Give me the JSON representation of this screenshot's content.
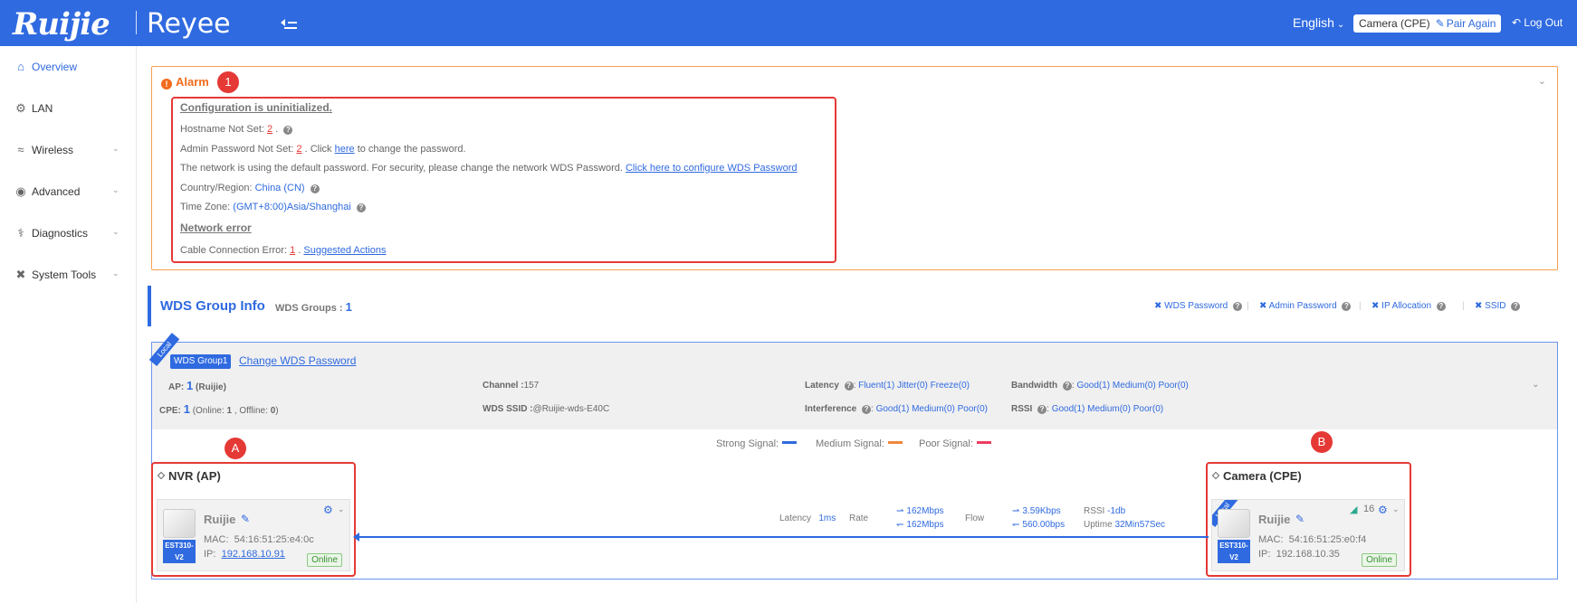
{
  "header": {
    "logo_left": "Ruijie",
    "logo_right": "Reyee",
    "language": "English",
    "pair_device": "Camera (CPE)",
    "pair_again": "Pair Again",
    "logout": "Log Out"
  },
  "sidebar": {
    "items": [
      {
        "label": "Overview"
      },
      {
        "label": "LAN"
      },
      {
        "label": "Wireless"
      },
      {
        "label": "Advanced"
      },
      {
        "label": "Diagnostics"
      },
      {
        "label": "System Tools"
      }
    ]
  },
  "alarm": {
    "title": "Alarm",
    "badge": "1",
    "config_heading": "Configuration is uninitialized.",
    "hostname_label": "Hostname Not Set:",
    "hostname_count": "2",
    "admin_label": "Admin Password Not Set:",
    "admin_count": "2",
    "admin_click": ". Click",
    "admin_here": "here",
    "admin_suffix": "to change the password.",
    "wds_text": "The network is using the default password. For security, please change the network WDS Password.",
    "wds_link": "Click here to configure WDS Password",
    "country_label": "Country/Region:",
    "country_value": "China (CN)",
    "timezone_label": "Time Zone:",
    "timezone_value": "(GMT+8:00)Asia/Shanghai",
    "network_heading": "Network error",
    "cable_label": "Cable Connection Error:",
    "cable_count": "1",
    "suggested": "Suggested Actions"
  },
  "wds": {
    "title": "WDS Group Info",
    "groups_label": "WDS Groups :",
    "groups_count": "1",
    "links": [
      "WDS Password",
      "Admin Password",
      "IP Allocation",
      "SSID"
    ]
  },
  "group": {
    "ribbon": "Local",
    "tag": "WDS Group1",
    "change_pw": "Change WDS Password",
    "ap_label": "AP:",
    "ap_count": "1",
    "ap_name": "(Ruijie)",
    "cpe_label": "CPE:",
    "cpe_count": "1",
    "cpe_online_label": "(Online:",
    "cpe_online": "1",
    "cpe_offline_label": ", Offline:",
    "cpe_offline": "0",
    "channel_label": "Channel :",
    "channel_value": "157",
    "ssid_label": "WDS SSID :",
    "ssid_value": "@Ruijie-wds-E40C",
    "latency_label": "Latency",
    "latency": [
      "Fluent(1)",
      "Jitter(0)",
      "Freeze(0)"
    ],
    "interference_label": "Interference",
    "interference": [
      "Good(1)",
      "Medium(0)",
      "Poor(0)"
    ],
    "bandwidth_label": "Bandwidth",
    "bandwidth": [
      "Good(1)",
      "Medium(0)",
      "Poor(0)"
    ],
    "rssi_label": "RSSI",
    "rssi": [
      "Good(1)",
      "Medium(0)",
      "Poor(0)"
    ],
    "legend": {
      "strong": "Strong Signal:",
      "medium": "Medium Signal:",
      "poor": "Poor Signal:",
      "colors": {
        "strong": "#2f6ae0",
        "medium": "#f0883a",
        "poor": "#ee3d5e"
      }
    }
  },
  "ap": {
    "title": "NVR (AP)",
    "badge": "A",
    "name": "Ruijie",
    "model_1": "EST310-",
    "model_2": "V2",
    "mac_label": "MAC:",
    "mac": "54:16:51:25:e4:0c",
    "ip_label": "IP:",
    "ip": "192.168.10.91",
    "status": "Online"
  },
  "cpe": {
    "title": "Camera (CPE)",
    "badge": "B",
    "ribbon": "Local",
    "name": "Ruijie",
    "model_1": "EST310-",
    "model_2": "V2",
    "mac_label": "MAC:",
    "mac": "54:16:51:25:e0:f4",
    "ip_label": "IP:",
    "ip": "192.168.10.35",
    "status": "Online",
    "signal": "16"
  },
  "link": {
    "latency_label": "Latency",
    "latency": "1ms",
    "rate_label": "Rate",
    "rate_up": "162Mbps",
    "rate_down": "162Mbps",
    "flow_label": "Flow",
    "flow_up": "3.59Kbps",
    "flow_down": "560.00bps",
    "rssi_label": "RSSI",
    "rssi": "-1db",
    "uptime_label": "Uptime",
    "uptime": "32Min57Sec"
  }
}
